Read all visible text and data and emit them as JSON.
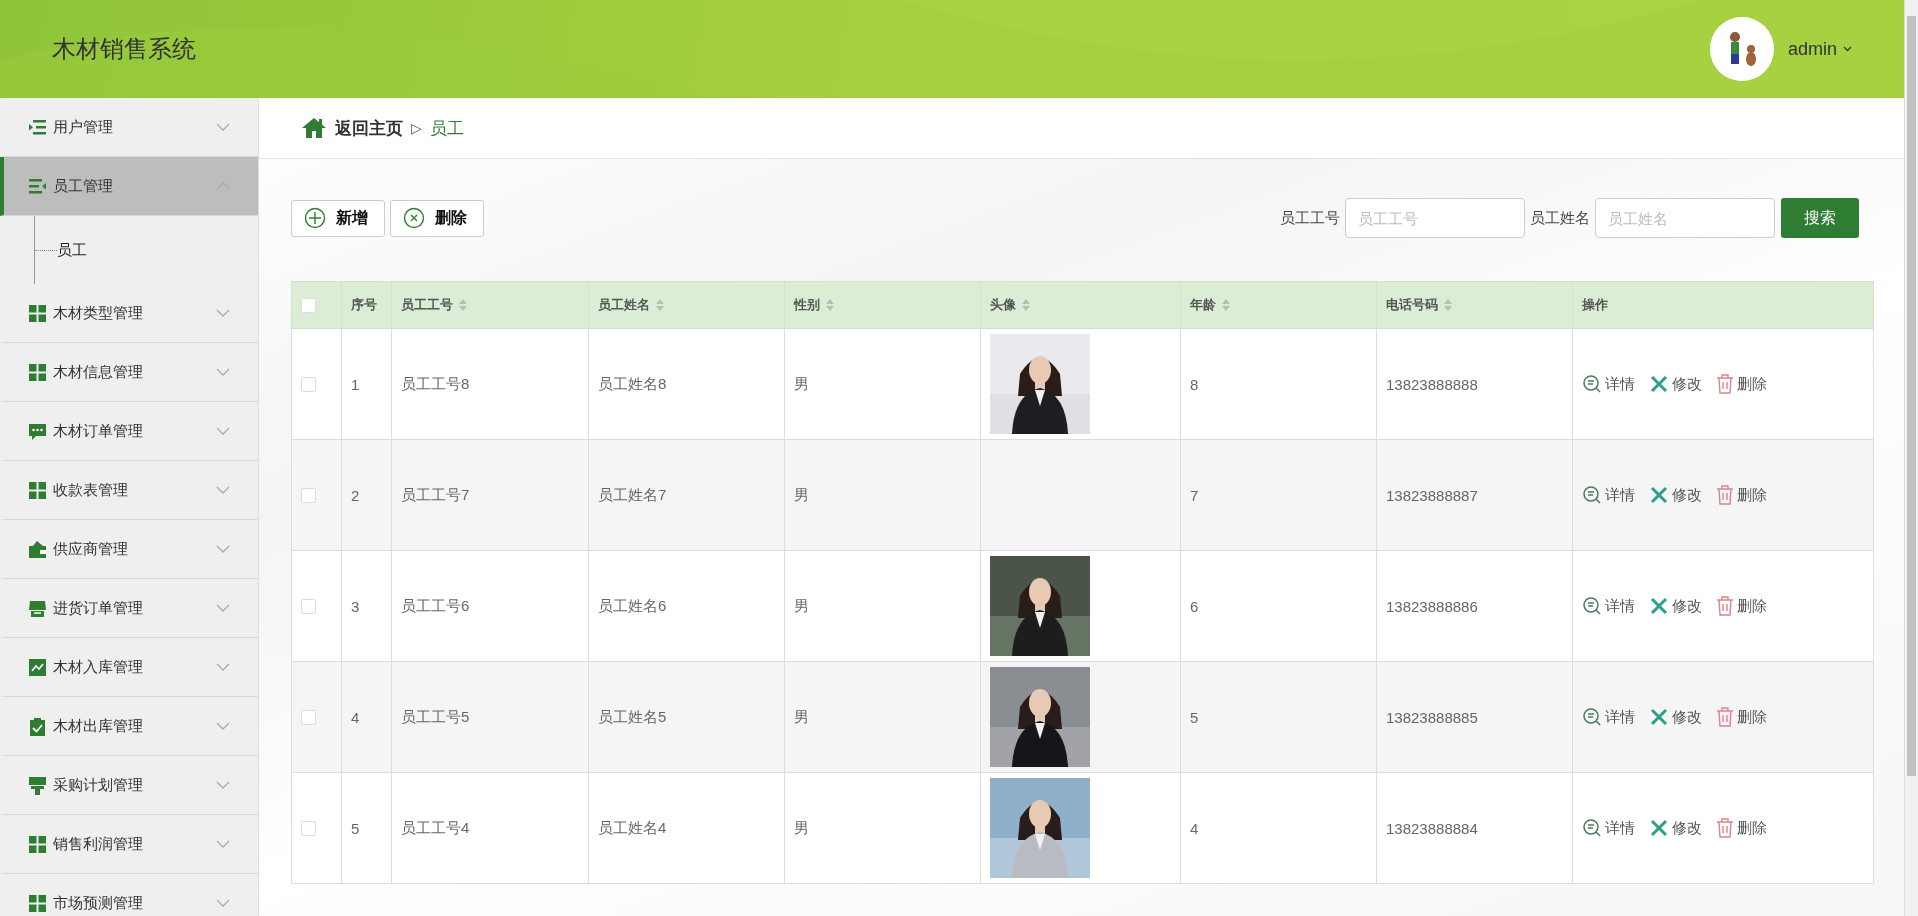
{
  "header": {
    "title": "木材销售系统",
    "user": "admin"
  },
  "sidebar": {
    "items": [
      {
        "label": "用户管理",
        "expanded": false,
        "selected": false
      },
      {
        "label": "员工管理",
        "expanded": true,
        "selected": true,
        "children": [
          {
            "label": "员工",
            "selected": false
          }
        ]
      },
      {
        "label": "木材类型管理",
        "expanded": false,
        "selected": false
      },
      {
        "label": "木材信息管理",
        "expanded": false,
        "selected": false
      },
      {
        "label": "木材订单管理",
        "expanded": false,
        "selected": false
      },
      {
        "label": "收款表管理",
        "expanded": false,
        "selected": false
      },
      {
        "label": "供应商管理",
        "expanded": false,
        "selected": false
      },
      {
        "label": "进货订单管理",
        "expanded": false,
        "selected": false
      },
      {
        "label": "木材入库管理",
        "expanded": false,
        "selected": false
      },
      {
        "label": "木材出库管理",
        "expanded": false,
        "selected": false
      },
      {
        "label": "采购计划管理",
        "expanded": false,
        "selected": false
      },
      {
        "label": "销售利润管理",
        "expanded": false,
        "selected": false
      },
      {
        "label": "市场预测管理",
        "expanded": false,
        "selected": false
      }
    ]
  },
  "breadcrumb": {
    "home": "返回主页",
    "separator": "▷",
    "current": "员工"
  },
  "toolbar": {
    "buttons": [
      {
        "kind": "add",
        "label": "新增"
      },
      {
        "kind": "delete",
        "label": "删除"
      }
    ]
  },
  "search": {
    "fields": [
      {
        "label": "员工工号",
        "placeholder": "员工工号"
      },
      {
        "label": "员工姓名",
        "placeholder": "员工姓名"
      }
    ],
    "button": "搜索"
  },
  "table": {
    "select_all_checked": false,
    "columns": [
      {
        "label": "序号",
        "sortable": false
      },
      {
        "label": "员工工号",
        "sortable": true
      },
      {
        "label": "员工姓名",
        "sortable": true
      },
      {
        "label": "性别",
        "sortable": true
      },
      {
        "label": "头像",
        "sortable": true
      },
      {
        "label": "年龄",
        "sortable": true
      },
      {
        "label": "电话号码",
        "sortable": true
      },
      {
        "label": "操作",
        "sortable": false
      }
    ],
    "rows": [
      {
        "checked": false,
        "index": "1",
        "id": "员工工号8",
        "name": "员工姓名8",
        "gender": "男",
        "photo": true,
        "age": "8",
        "phone": "13823888888",
        "actions": [
          "详情",
          "修改",
          "删除"
        ]
      },
      {
        "checked": false,
        "index": "2",
        "id": "员工工号7",
        "name": "员工姓名7",
        "gender": "男",
        "photo": false,
        "age": "7",
        "phone": "13823888887",
        "actions": [
          "详情",
          "修改",
          "删除"
        ]
      },
      {
        "checked": false,
        "index": "3",
        "id": "员工工号6",
        "name": "员工姓名6",
        "gender": "男",
        "photo": true,
        "age": "6",
        "phone": "13823888886",
        "actions": [
          "详情",
          "修改",
          "删除"
        ]
      },
      {
        "checked": false,
        "index": "4",
        "id": "员工工号5",
        "name": "员工姓名5",
        "gender": "男",
        "photo": true,
        "age": "5",
        "phone": "13823888885",
        "actions": [
          "详情",
          "修改",
          "删除"
        ]
      },
      {
        "checked": false,
        "index": "5",
        "id": "员工工号4",
        "name": "员工姓名4",
        "gender": "男",
        "photo": true,
        "age": "4",
        "phone": "13823888884",
        "actions": [
          "详情",
          "修改",
          "删除"
        ]
      }
    ]
  }
}
